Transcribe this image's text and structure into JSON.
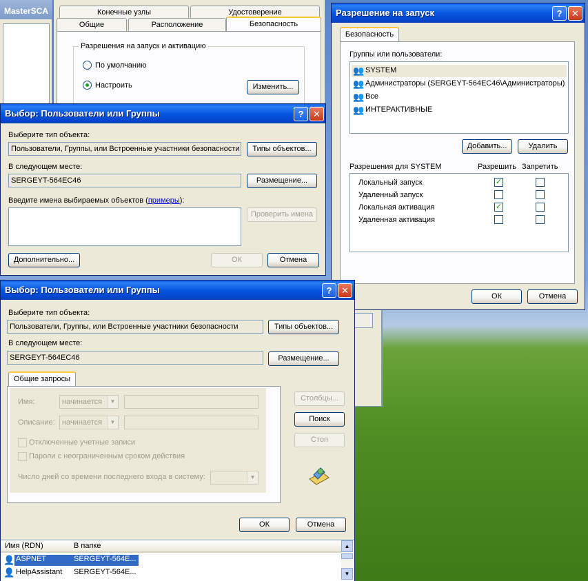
{
  "background_window": {
    "title": "MasterSCA",
    "tabs_row1": [
      "Конечные узлы",
      "Удостоверение"
    ],
    "tabs_row2": [
      "Общие",
      "Расположение",
      "Безопасность"
    ],
    "group_title": "Разрешения на запуск и активацию",
    "radio_default": "По умолчанию",
    "radio_custom": "Настроить",
    "change_button": "Изменить..."
  },
  "launch_dialog": {
    "title": "Разрешение на запуск",
    "help_glyph": "?",
    "close_glyph": "✕",
    "tab": "Безопасность",
    "groups_label": "Группы или пользователи:",
    "groups": [
      "SYSTEM",
      "Администраторы (SERGEYT-564EC46\\Администраторы)",
      "Все",
      "ИНТЕРАКТИВНЫЕ"
    ],
    "add_button": "Добавить...",
    "remove_button": "Удалить",
    "perms_label": "Разрешения для SYSTEM",
    "allow_col": "Разрешить",
    "deny_col": "Запретить",
    "perms": [
      {
        "name": "Локальный запуск",
        "allow": true,
        "deny": false
      },
      {
        "name": "Удаленный запуск",
        "allow": false,
        "deny": false
      },
      {
        "name": "Локальная активация",
        "allow": true,
        "deny": false
      },
      {
        "name": "Удаленная активация",
        "allow": false,
        "deny": false
      }
    ],
    "ok": "ОК",
    "cancel": "Отмена"
  },
  "select_dialog_1": {
    "title": "Выбор: Пользователи или Группы",
    "object_type_label": "Выберите тип объекта:",
    "object_type_value": "Пользователи, Группы, или Встроенные участники безопасности",
    "object_types_button": "Типы объектов...",
    "location_label": "В следующем месте:",
    "location_value": "SERGEYT-564EC46",
    "location_button": "Размещение...",
    "names_label": "Введите имена выбираемых объектов (",
    "names_link": "примеры",
    "names_label_end": "):",
    "check_names_button": "Проверить имена",
    "advanced_button": "Дополнительно...",
    "ok": "ОК",
    "cancel": "Отмена"
  },
  "select_dialog_2": {
    "title": "Выбор: Пользователи или Группы",
    "object_type_label": "Выберите тип объекта:",
    "object_type_value": "Пользователи, Группы, или Встроенные участники безопасности",
    "object_types_button": "Типы объектов...",
    "location_label": "В следующем месте:",
    "location_value": "SERGEYT-564EC46",
    "location_button": "Размещение...",
    "tab": "Общие запросы",
    "name_label": "Имя:",
    "name_combo": "начинается",
    "desc_label": "Описание:",
    "desc_combo": "начинается",
    "disabled_accounts": "Отключенные учетные записи",
    "nonexpiring_pw": "Пароли с неограниченным сроком действия",
    "days_label": "Число дней со времени последнего входа в систему:",
    "columns_button": "Столбцы...",
    "search_button": "Поиск",
    "stop_button": "Стоп",
    "ok": "ОК",
    "cancel": "Отмена",
    "results_headers": [
      "Имя (RDN)",
      "В папке"
    ],
    "results": [
      {
        "name": "ASPNET",
        "folder": "SERGEYT-564E..."
      },
      {
        "name": "HelpAssistant",
        "folder": "SERGEYT-564E..."
      }
    ]
  }
}
